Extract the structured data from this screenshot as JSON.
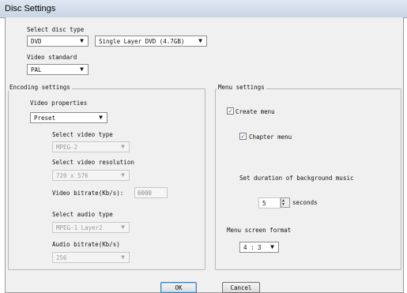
{
  "window": {
    "title": "Disc Settings"
  },
  "disc": {
    "label": "Select disc type",
    "type_value": "DVD",
    "layer_value": "Single Layer DVD (4.7GB)",
    "video_standard_label": "Video standard",
    "video_standard_value": "PAL"
  },
  "encoding": {
    "group_title": "Encoding settings",
    "video_properties_label": "Video properties",
    "video_properties_value": "Preset",
    "video_type_label": "Select video type",
    "video_type_value": "MPEG-2",
    "video_resolution_label": "Select video resolution",
    "video_resolution_value": "720 x 576",
    "video_bitrate_label": "Video bitrate(Kb/s):",
    "video_bitrate_value": "6000",
    "audio_type_label": "Select audio type",
    "audio_type_value": "MPEG-1 Layer2",
    "audio_bitrate_label": "Audio bitrate(Kb/s)",
    "audio_bitrate_value": "256"
  },
  "menu": {
    "group_title": "Menu settings",
    "create_menu_label": "Create menu",
    "create_menu_checked": true,
    "chapter_menu_label": "Chapter menu",
    "chapter_menu_checked": true,
    "bg_music_label": "Set duration of background music",
    "bg_music_value": "5",
    "bg_music_unit": "seconds",
    "screen_format_label": "Menu screen format",
    "screen_format_value": "4 : 3"
  },
  "buttons": {
    "ok_label": "OK",
    "cancel_label": "Cancel"
  },
  "icons": {
    "dropdown": "chevron-down-icon",
    "check": "checkmark-icon",
    "spin": "spin-arrows-icon"
  }
}
